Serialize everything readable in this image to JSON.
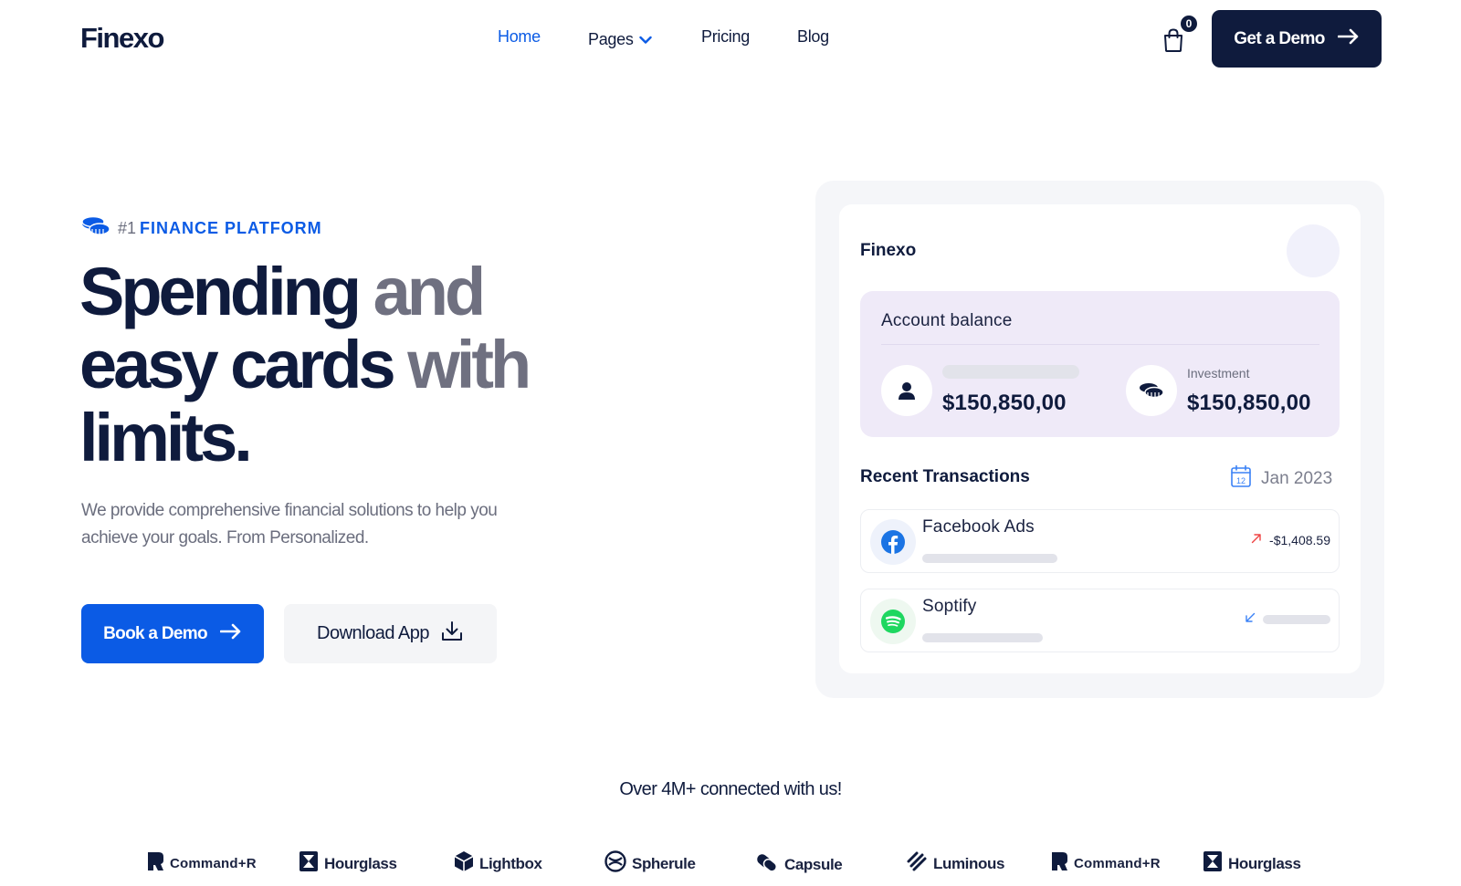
{
  "header": {
    "logo": "Finexo",
    "nav": [
      {
        "label": "Home"
      },
      {
        "label": "Pages"
      },
      {
        "label": "Pricing"
      },
      {
        "label": "Blog"
      }
    ],
    "cart_count": "0",
    "cta_label": "Get a Demo"
  },
  "hero": {
    "eyebrow_number": "#1",
    "eyebrow_text": "FINANCE PLATFORM",
    "headline": {
      "part1": "Spending",
      "part2": " and",
      "part3": "easy cards",
      "part4": " with",
      "part5": "limits."
    },
    "subtext": "We provide comprehensive financial solutions to help you achieve your goals. From Personalized.",
    "primary_button": "Book a Demo",
    "secondary_button": "Download App"
  },
  "dashboard": {
    "brand": "Finexo",
    "balance_title": "Account balance",
    "balance_amount": "$150,850,00",
    "investment_label": "Investment",
    "investment_amount": "$150,850,00",
    "recent_title": "Recent Transactions",
    "date_icon_day": "12",
    "date": "Jan 2023",
    "transactions": [
      {
        "name": "Facebook Ads",
        "amount": "-$1,408.59",
        "direction": "up-right",
        "color": "#ef4444"
      },
      {
        "name": "Soptify",
        "amount": "",
        "direction": "down-left",
        "color": "#3b82f6"
      }
    ]
  },
  "social_proof": {
    "headline": "Over 4M+ connected with us!",
    "logos": [
      "Command+R",
      "Hourglass",
      "Lightbox",
      "Spherule",
      "Capsule",
      "Luminous",
      "Command+R",
      "Hourglass"
    ]
  },
  "colors": {
    "brand_blue": "#0b5be5",
    "navy": "#0f1b3d",
    "balance_bg": "#efeaf8"
  }
}
